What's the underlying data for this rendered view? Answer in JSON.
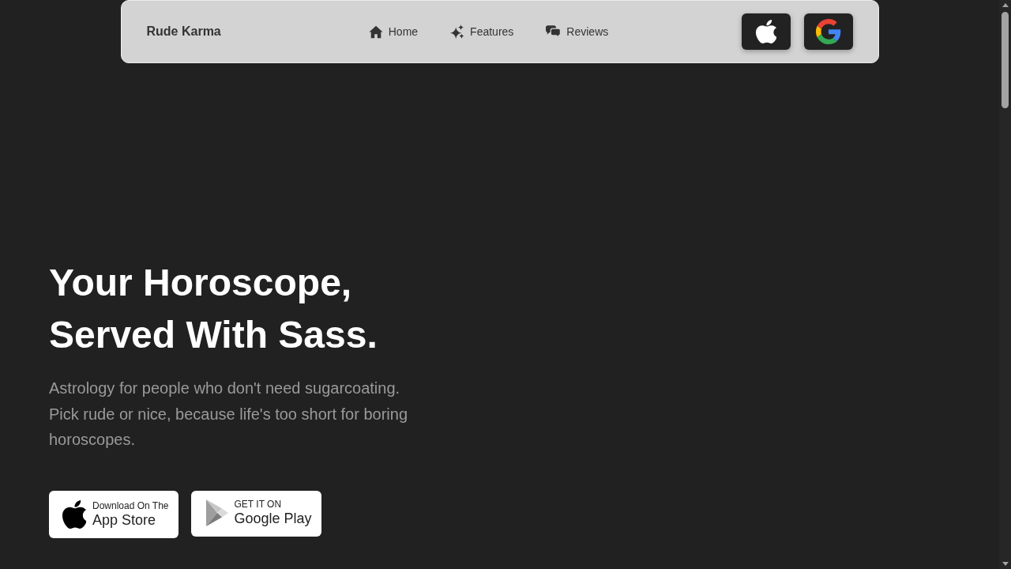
{
  "navbar": {
    "brand": "Rude Karma",
    "links": [
      {
        "label": "Home"
      },
      {
        "label": "Features"
      },
      {
        "label": "Reviews"
      }
    ]
  },
  "hero": {
    "title": "Your Horoscope, Served With Sass.",
    "subtitle": "Astrology for people who don't need sugarcoating. Pick rude or nice, because life's too short for boring horoscopes.",
    "badges": [
      {
        "caption": "Download On The",
        "label": "App Store"
      },
      {
        "caption": "GET IT ON",
        "label": "Google Play"
      }
    ]
  }
}
